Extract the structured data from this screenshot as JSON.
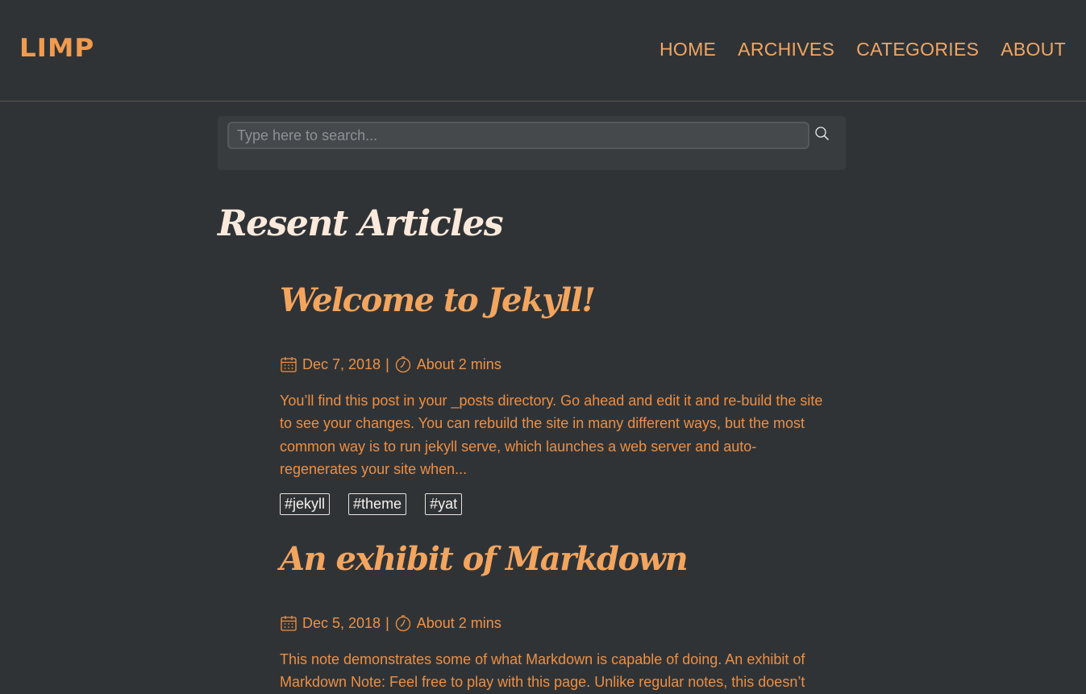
{
  "header": {
    "logo": "LIMP",
    "nav": [
      "HOME",
      "ARCHIVES",
      "CATEGORIES",
      "ABOUT"
    ]
  },
  "search": {
    "placeholder": "Type here to search..."
  },
  "section_title": "Resent Articles",
  "articles": [
    {
      "title": "Welcome to Jekyll!",
      "date": "Dec 7, 2018",
      "separator": "|",
      "read_time": "About 2 mins",
      "excerpt": "You’ll find this post in your _posts directory. Go ahead and edit it and re-build the site to see your changes. You can rebuild the site in many different ways, but the most common way is to run jekyll serve, which launches a web server and auto-regenerates your site when...",
      "tags": [
        "#jekyll",
        "#theme",
        "#yat"
      ]
    },
    {
      "title": "An exhibit of Markdown",
      "date": "Dec 5, 2018",
      "separator": "|",
      "read_time": "About 2 mins",
      "excerpt": "This note demonstrates some of what Markdown is capable of doing. An exhibit of Markdown Note: Feel free to play with this page. Unlike regular notes, this doesn’t"
    }
  ]
}
